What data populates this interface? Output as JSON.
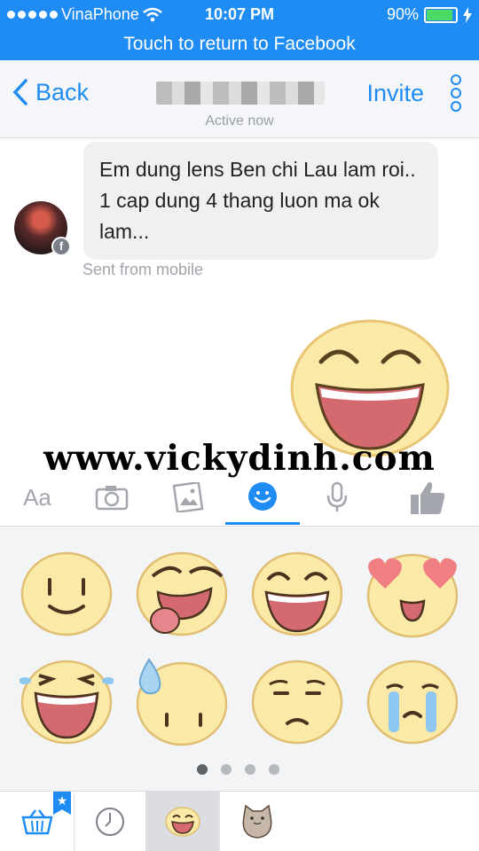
{
  "status_bar": {
    "carrier": "VinaPhone",
    "time": "10:07 PM",
    "battery_percent": "90%",
    "battery_level": 0.9
  },
  "return_bar": {
    "label": "Touch to return to Facebook"
  },
  "nav": {
    "back_label": "Back",
    "presence": "Active now",
    "invite_label": "Invite"
  },
  "conversation": {
    "message": "Em dung lens Ben chi Lau lam roi.. 1 cap dung 4 thang luon ma ok lam...",
    "meta": "Sent from mobile",
    "watermark": "www.vickydinh.com"
  },
  "composer": {
    "text_tool_label": "Aa",
    "tools": [
      "text",
      "camera",
      "gallery",
      "stickers",
      "microphone",
      "like"
    ],
    "active_tool": "stickers"
  },
  "sticker_panel": {
    "pages": 4,
    "current_page": 1
  },
  "colors": {
    "accent": "#1e8cf3",
    "battery": "#4cd964",
    "bubble": "#f0f0f2"
  }
}
